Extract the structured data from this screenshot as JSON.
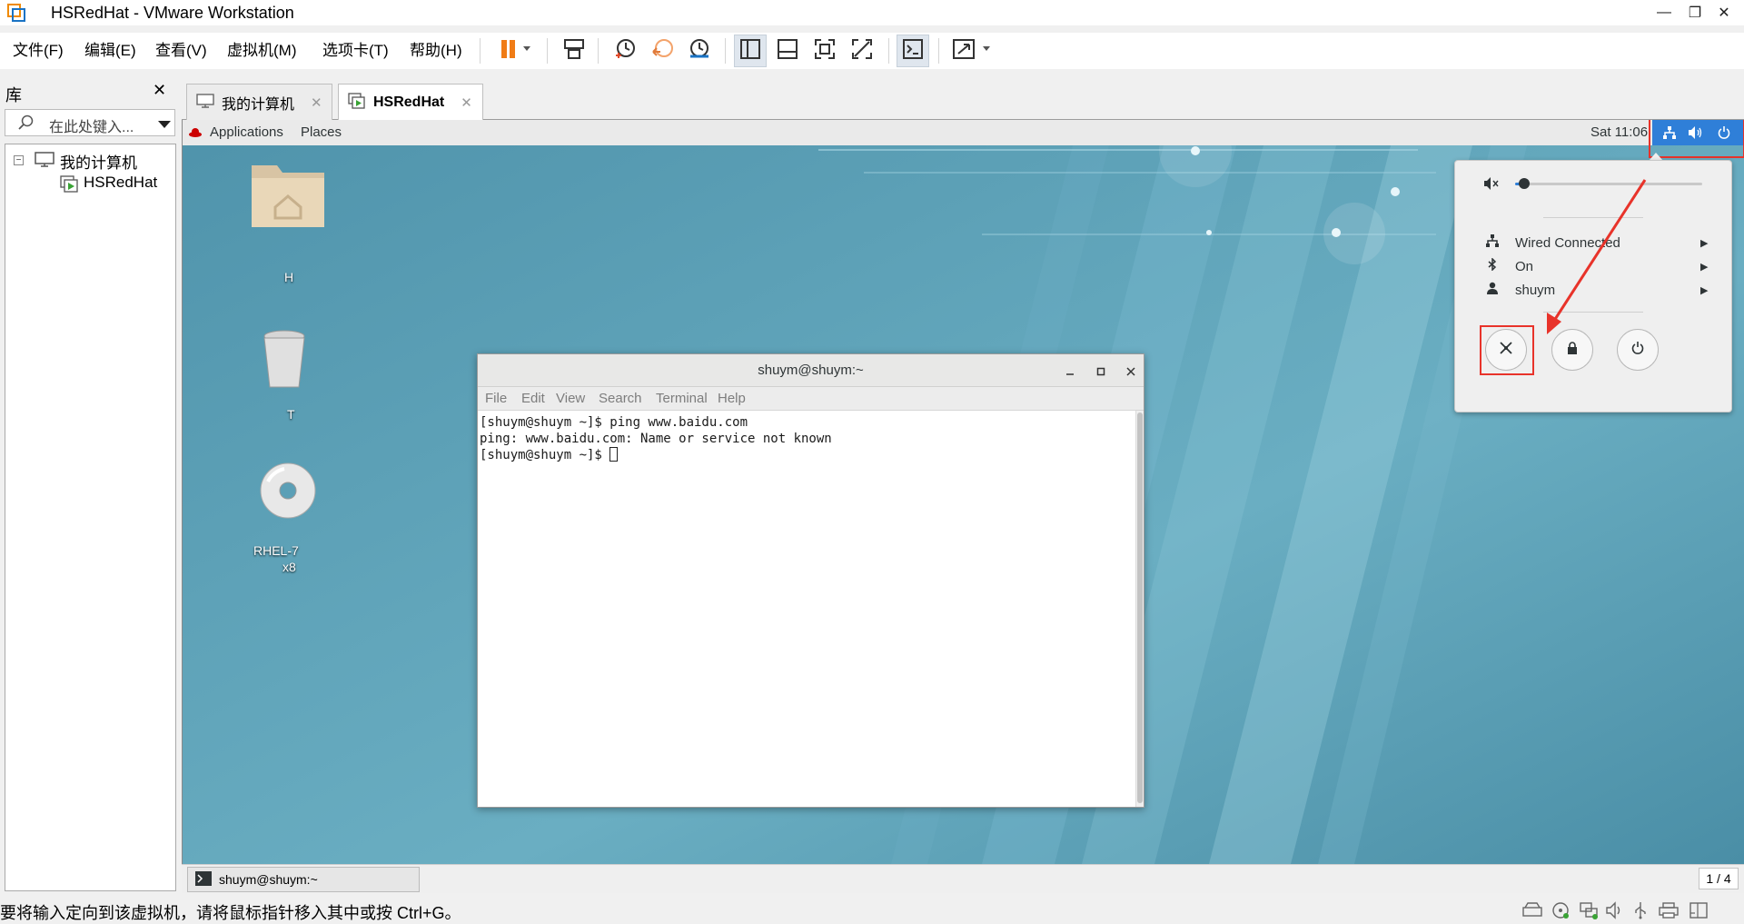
{
  "window": {
    "title": "HSRedHat - VMware Workstation",
    "minimize": "—",
    "restore": "❐",
    "close": "✕"
  },
  "menubar": {
    "items": [
      "文件(F)",
      "编辑(E)",
      "查看(V)",
      "虚拟机(M)",
      "选项卡(T)",
      "帮助(H)"
    ]
  },
  "toolbar": {
    "icons": [
      "pause-icon",
      "send-ctrl-alt-del-icon",
      "snapshot-icon",
      "revert-snapshot-icon",
      "snapshot-manager-icon",
      "library-view-icon",
      "thumbnail-view-icon",
      "fullscreen-icon",
      "unity-icon",
      "console-icon",
      "stretch-icon"
    ]
  },
  "library": {
    "title": "库",
    "close": "✕",
    "search_placeholder": "在此处键入...",
    "tree": {
      "root": "我的计算机",
      "child": "HSRedHat"
    }
  },
  "tabs": [
    {
      "label": "我的计算机",
      "close": "✕"
    },
    {
      "label": "HSRedHat",
      "close": "✕"
    }
  ],
  "guest": {
    "topbar": {
      "applications": "Applications",
      "places": "Places",
      "clock": "Sat 11:06"
    },
    "desktop_icons": [
      {
        "label": "H"
      },
      {
        "label": "T"
      },
      {
        "label": "RHEL-7"
      },
      {
        "label": "x8"
      }
    ],
    "terminal": {
      "title": "shuym@shuym:~",
      "menu": [
        "File",
        "Edit",
        "View",
        "Search",
        "Terminal",
        "Help"
      ],
      "lines": [
        "[shuym@shuym ~]$ ping www.baidu.com",
        "ping: www.baidu.com: Name or service not known",
        "[shuym@shuym ~]$ "
      ]
    },
    "system_menu": {
      "volume_level": 0.05,
      "items": [
        {
          "icon": "network-wired-icon",
          "label": "Wired Connected"
        },
        {
          "icon": "bluetooth-icon",
          "label": "On"
        },
        {
          "icon": "user-icon",
          "label": "shuym"
        }
      ],
      "buttons": [
        "settings-icon",
        "lock-icon",
        "power-icon"
      ]
    },
    "taskbar": {
      "item": "shuym@shuym:~",
      "workspace": "1 / 4"
    }
  },
  "statusbar": {
    "text": "要将输入定向到该虚拟机，请将鼠标指针移入其中或按 Ctrl+G。"
  },
  "colors": {
    "desktop": "#5b9fb6",
    "annotation": "#e8332a",
    "pause_orange": "#f07c16",
    "selection_blue": "#2f7fd8"
  }
}
